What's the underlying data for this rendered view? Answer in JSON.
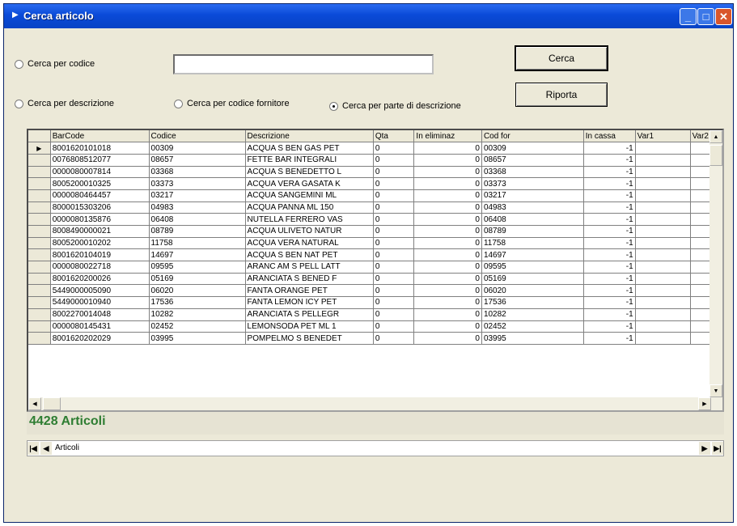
{
  "window": {
    "title": "Cerca articolo",
    "min_label": "_",
    "max_label": "□",
    "close_label": "✕"
  },
  "search": {
    "radio_codice": "Cerca per codice",
    "radio_descrizione": "Cerca per descrizione",
    "radio_fornitore": "Cerca per codice fornitore",
    "radio_parte": "Cerca per parte di descrizione",
    "selected": "radio_parte",
    "value": ""
  },
  "buttons": {
    "cerca": "Cerca",
    "riporta": "Riporta"
  },
  "grid": {
    "columns": [
      "BarCode",
      "Codice",
      "Descrizione",
      "Qta",
      "In eliminaz",
      "Cod for",
      "In cassa",
      "Var1",
      "Var2"
    ],
    "rows": [
      [
        "8001620101018",
        "00309",
        "ACQUA S BEN GAS PET",
        "0",
        "0",
        "00309",
        "-1",
        "",
        ""
      ],
      [
        "0076808512077",
        "08657",
        "FETTE BAR INTEGRALI",
        "0",
        "0",
        "08657",
        "-1",
        "",
        ""
      ],
      [
        "0000080007814",
        "03368",
        "ACQUA S BENEDETTO L",
        "0",
        "0",
        "03368",
        "-1",
        "",
        ""
      ],
      [
        "8005200010325",
        "03373",
        "ACQUA VERA GASATA K",
        "0",
        "0",
        "03373",
        "-1",
        "",
        ""
      ],
      [
        "0000080464457",
        "03217",
        "ACQUA SANGEMINI  ML",
        "0",
        "0",
        "03217",
        "-1",
        "",
        ""
      ],
      [
        "8000015303206",
        "04983",
        "ACQUA PANNA  ML 150",
        "0",
        "0",
        "04983",
        "-1",
        "",
        ""
      ],
      [
        "0000080135876",
        "06408",
        "NUTELLA FERRERO VAS",
        "0",
        "0",
        "06408",
        "-1",
        "",
        ""
      ],
      [
        "8008490000021",
        "08789",
        "ACQUA ULIVETO NATUR",
        "0",
        "0",
        "08789",
        "-1",
        "",
        ""
      ],
      [
        "8005200010202",
        "11758",
        "ACQUA VERA NATURAL",
        "0",
        "0",
        "11758",
        "-1",
        "",
        ""
      ],
      [
        "8001620104019",
        "14697",
        "ACQUA S BEN NAT PET",
        "0",
        "0",
        "14697",
        "-1",
        "",
        ""
      ],
      [
        "0000080022718",
        "09595",
        "ARANC AM S PELL LATT",
        "0",
        "0",
        "09595",
        "-1",
        "",
        ""
      ],
      [
        "8001620200026",
        "05169",
        "ARANCIATA S BENED  F",
        "0",
        "0",
        "05169",
        "-1",
        "",
        ""
      ],
      [
        "5449000005090",
        "06020",
        "FANTA ORANGE PET",
        "0",
        "0",
        "06020",
        "-1",
        "",
        ""
      ],
      [
        "5449000010940",
        "17536",
        "FANTA LEMON ICY PET",
        "0",
        "0",
        "17536",
        "-1",
        "",
        ""
      ],
      [
        "8002270014048",
        "10282",
        "ARANCIATA S PELLEGR",
        "0",
        "0",
        "10282",
        "-1",
        "",
        ""
      ],
      [
        "0000080145431",
        "02452",
        "LEMONSODA PET  ML 1",
        "0",
        "0",
        "02452",
        "-1",
        "",
        ""
      ],
      [
        "8001620202029",
        "03995",
        "POMPELMO S BENEDET",
        "0",
        "0",
        "03995",
        "-1",
        "",
        ""
      ]
    ]
  },
  "count_label": "4428 Articoli",
  "nav": {
    "label": "Articoli"
  }
}
